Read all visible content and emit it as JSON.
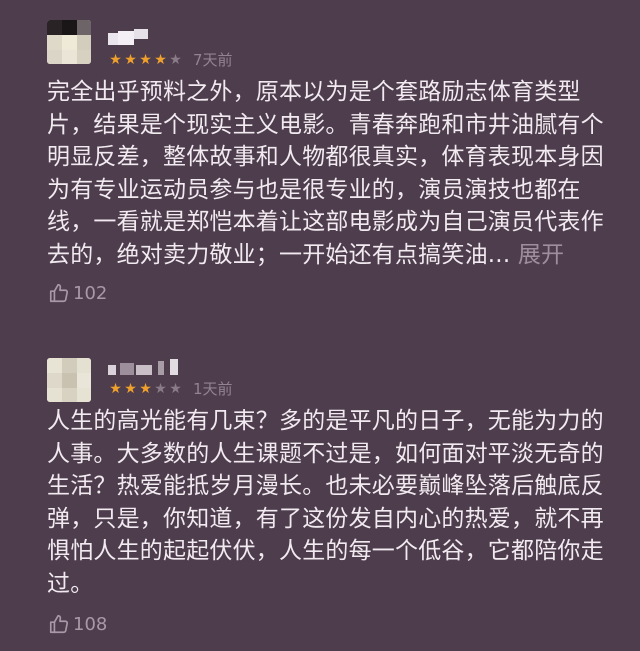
{
  "comments": [
    {
      "rating": 4,
      "max_rating": 5,
      "time": "7天前",
      "text_lines": [
        "完全出乎预料之外，原本以为是个套路励志体育类型",
        "片，结果是个现实主义电影。青春奔跑和市井油腻有个",
        "明显反差，整体故事和人物都很真实，体育表现本身因",
        "为有专业运动员参与也是很专业的，演员演技也都在",
        "线，一看就是郑恺本着让这部电影成为自己演员代表作"
      ],
      "last_line": "去的，绝对卖力敬业；一开始还有点搞笑油...",
      "expand_label": "展开",
      "likes": "102"
    },
    {
      "rating": 3,
      "max_rating": 5,
      "time": "1天前",
      "text_lines": [
        "人生的高光能有几束？多的是平凡的日子，无能为力的",
        "人事。大多数的人生课题不过是，如何面对平淡无奇的",
        "生活？热爱能抵岁月漫长。也未必要巅峰坠落后触底反",
        "弹，只是，你知道，有了这份发自内心的热爱，就不再",
        "惧怕人生的起起伏伏，人生的每一个低谷，它都陪你走",
        "过。"
      ],
      "likes": "108"
    }
  ],
  "colors": {
    "background": "#4e3d4d",
    "text": "#f1eaf0",
    "muted": "#928392",
    "star_filled": "#f0a12c",
    "star_empty": "#8a7b88"
  },
  "icons": {
    "like": "thumbs-up-icon",
    "star": "star-icon"
  }
}
